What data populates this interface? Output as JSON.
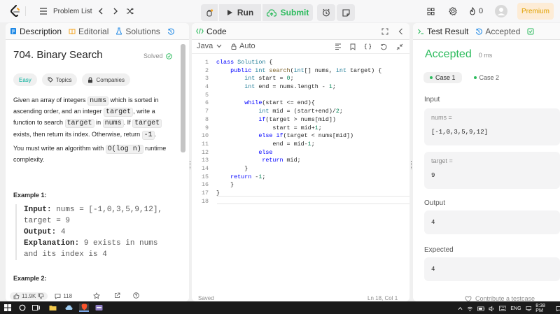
{
  "topbar": {
    "problem_list": "Problem List",
    "run": "Run",
    "submit": "Submit",
    "streak": "0",
    "premium": "Premium"
  },
  "description_panel": {
    "tabs": [
      "Description",
      "Editorial",
      "Solutions"
    ],
    "title": "704. Binary Search",
    "solved": "Solved",
    "tags": [
      "Easy",
      "Topics",
      "Companies"
    ],
    "para1": [
      {
        "t": "Given an array of integers "
      },
      {
        "c": "nums"
      },
      {
        "t": " which is sorted in ascending order, and an integer "
      },
      {
        "c": "target"
      },
      {
        "t": ", write a function to search "
      },
      {
        "c": "target"
      },
      {
        "t": " in "
      },
      {
        "c": "nums"
      },
      {
        "t": ". If "
      },
      {
        "c": "target"
      },
      {
        "t": " exists, then return its index. Otherwise, return "
      },
      {
        "c": "-1"
      },
      {
        "t": "."
      }
    ],
    "para2_prefix": "You must write an algorithm with ",
    "para2_code": "O(log n)",
    "para2_suffix": " runtime complexity.",
    "example1_title": "Example 1:",
    "example1": {
      "input_label": "Input:",
      "input_value": " nums = [-1,0,3,5,9,12], target = 9",
      "output_label": "Output:",
      "output_value": " 4",
      "explanation_label": "Explanation:",
      "explanation_value": " 9 exists in nums and its index is 4"
    },
    "example2_title": "Example 2:",
    "footer": {
      "likes": "11.9K",
      "comments": "118"
    }
  },
  "code_panel": {
    "tab": "Code",
    "language": "Java",
    "mode": "Auto",
    "lines": [
      "class Solution {",
      "    public int search(int[] nums, int target) {",
      "        int start = 0;",
      "        int end = nums.length - 1;",
      "",
      "        while(start <= end){",
      "            int mid = (start+end)/2;",
      "            if(target > nums[mid])",
      "                start = mid+1;",
      "            else if(target < nums[mid])",
      "                end = mid-1;",
      "            else",
      "             return mid;",
      "        }",
      "    return -1;",
      "    }",
      "}",
      ""
    ],
    "status_left": "Saved",
    "status_right": "Ln 18, Col 1"
  },
  "result_panel": {
    "tabs": [
      "Test Result",
      "Accepted"
    ],
    "verdict": "Accepted",
    "runtime": "0 ms",
    "cases": [
      "Case 1",
      "Case 2"
    ],
    "input_heading": "Input",
    "nums_label": "nums =",
    "nums_value": "[-1,0,3,5,9,12]",
    "target_label": "target =",
    "target_value": "9",
    "output_heading": "Output",
    "output_value": "4",
    "expected_heading": "Expected",
    "expected_value": "4",
    "contribute": "Contribute a testcase"
  },
  "taskbar": {
    "lang": "ENG",
    "time": "8:38 PM"
  },
  "colors": {
    "accent_green": "#2cbb5d",
    "easy_tag": "#00af9b",
    "premium": "#ffa116"
  }
}
